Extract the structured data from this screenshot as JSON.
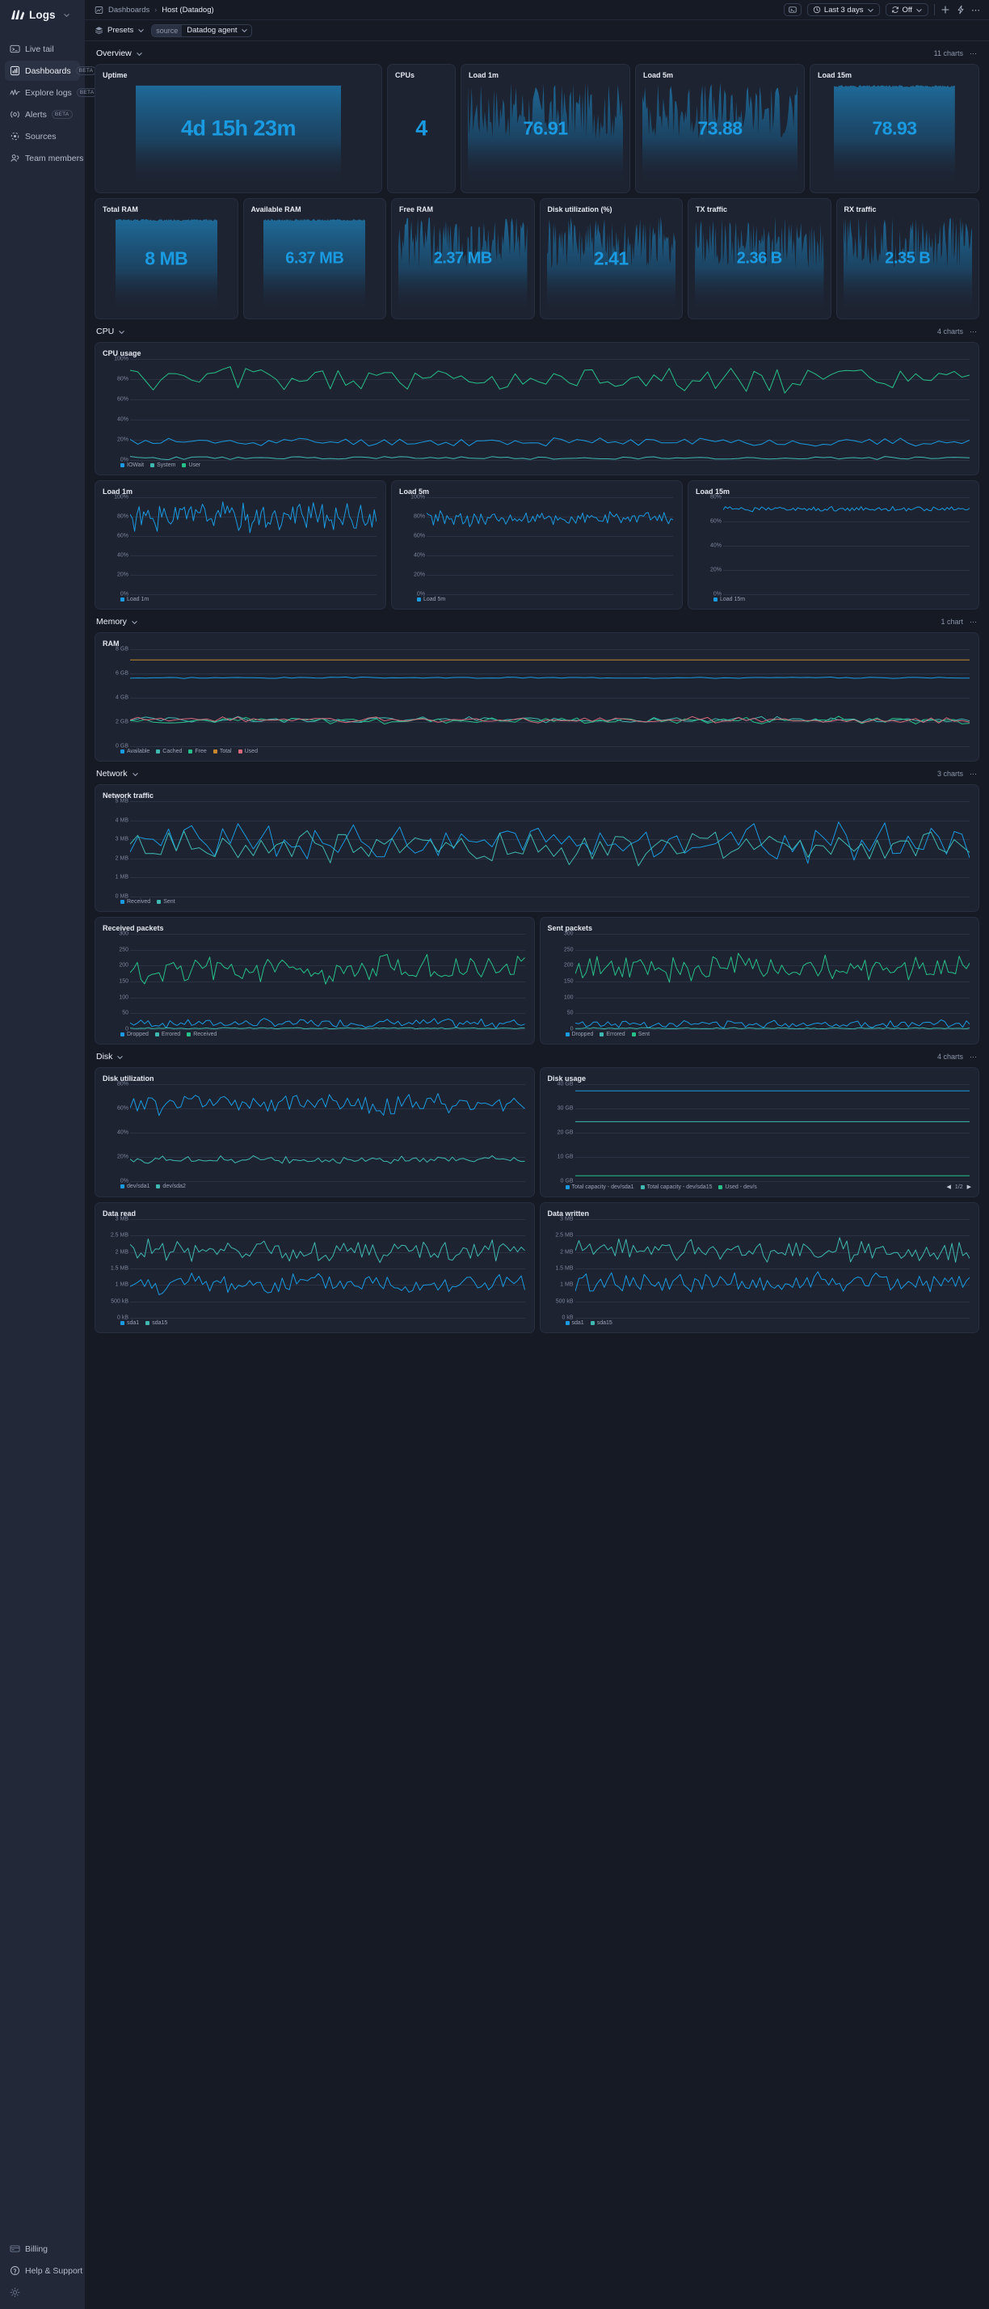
{
  "brand": {
    "name": "Logs",
    "logo_icon": "logs-logo-icon",
    "caret_icon": "chevron-down-icon"
  },
  "sidebar": {
    "items": [
      {
        "label": "Live tail",
        "icon": "terminal-icon",
        "badge": null,
        "active": false
      },
      {
        "label": "Dashboards",
        "icon": "bar-chart-icon",
        "badge": "BETA",
        "active": true
      },
      {
        "label": "Explore logs",
        "icon": "pulse-icon",
        "badge": "BETA",
        "active": false
      },
      {
        "label": "Alerts",
        "icon": "bell-icon",
        "badge": "BETA",
        "active": false
      },
      {
        "label": "Sources",
        "icon": "sources-icon",
        "badge": null,
        "active": false
      },
      {
        "label": "Team members",
        "icon": "users-icon",
        "badge": null,
        "active": false
      }
    ],
    "bottom_items": [
      {
        "label": "Billing",
        "icon": "credit-card-icon"
      },
      {
        "label": "Help & Support",
        "icon": "question-circle-icon"
      }
    ],
    "theme_toggle_icon": "sun-icon"
  },
  "topbar": {
    "breadcrumb_icon": "dashboard-icon",
    "breadcrumb_root": "Dashboards",
    "breadcrumb_sep": "›",
    "breadcrumb_current": "Host (Datadog)",
    "terminal_button_icon": "terminal-icon",
    "time_range": {
      "icon": "clock-icon",
      "label": "Last 3 days",
      "caret": "chevron-down-icon"
    },
    "refresh": {
      "icon": "refresh-icon",
      "label": "Off",
      "caret": "chevron-down-icon"
    },
    "add_icon": "plus-icon",
    "bolt_icon": "lightning-icon",
    "more_icon": "ellipsis-icon"
  },
  "filterbar": {
    "presets_icon": "layers-icon",
    "presets_label": "Presets",
    "presets_caret": "chevron-down-icon",
    "tag_key": "source",
    "tag_value": "Datadog agent",
    "tag_caret": "chevron-down-icon"
  },
  "sections": [
    {
      "id": "overview",
      "title": "Overview",
      "count": "11 charts"
    },
    {
      "id": "cpu",
      "title": "CPU",
      "count": "4 charts"
    },
    {
      "id": "memory",
      "title": "Memory",
      "count": "1 chart"
    },
    {
      "id": "network",
      "title": "Network",
      "count": "3 charts"
    },
    {
      "id": "disk",
      "title": "Disk",
      "count": "4 charts"
    }
  ],
  "overview_row1": [
    {
      "title": "Uptime",
      "value": "4d 15h 23m",
      "size": "lg",
      "spark": "flat"
    },
    {
      "title": "CPUs",
      "value": "4",
      "size": "lg",
      "spark": "none"
    },
    {
      "title": "Load 1m",
      "value": "76.91",
      "size": "md",
      "spark": "noisy"
    },
    {
      "title": "Load 5m",
      "value": "73.88",
      "size": "md",
      "spark": "noisy"
    },
    {
      "title": "Load 15m",
      "value": "78.93",
      "size": "md",
      "spark": "block"
    }
  ],
  "overview_row2": [
    {
      "title": "Total RAM",
      "value": "8 MB",
      "size": "md",
      "spark": "block"
    },
    {
      "title": "Available RAM",
      "value": "6.37 MB",
      "size": "sm",
      "spark": "block"
    },
    {
      "title": "Free RAM",
      "value": "2.37 MB",
      "size": "sm",
      "spark": "noisy"
    },
    {
      "title": "Disk utilization (%)",
      "value": "2.41",
      "size": "md",
      "spark": "noisy"
    },
    {
      "title": "TX traffic",
      "value": "2.36 B",
      "size": "sm",
      "spark": "noisy"
    },
    {
      "title": "RX traffic",
      "value": "2.35 B",
      "size": "sm",
      "spark": "noisy"
    }
  ],
  "chart_data": [
    {
      "id": "cpu-usage",
      "type": "line",
      "title": "CPU usage",
      "ylabel": "",
      "xlabel": "",
      "yticks": [
        "100%",
        "80%",
        "60%",
        "40%",
        "20%",
        "0%"
      ],
      "ylim": [
        0,
        100
      ],
      "grid": true,
      "legend_position": "bottom",
      "series": [
        {
          "name": "IOWait",
          "color": "#1a9ae0",
          "mean": 18,
          "amp": 4,
          "seed": 11
        },
        {
          "name": "System",
          "color": "#3fb9b0",
          "mean": 2,
          "amp": 1.5,
          "seed": 23
        },
        {
          "name": "User",
          "color": "#27c08a",
          "mean": 80,
          "amp": 12,
          "seed": 5
        }
      ]
    },
    {
      "id": "load-1m",
      "type": "line",
      "title": "Load 1m",
      "yticks": [
        "100%",
        "80%",
        "60%",
        "40%",
        "20%",
        "0%"
      ],
      "ylim": [
        0,
        100
      ],
      "grid": true,
      "series": [
        {
          "name": "Load 1m",
          "color": "#1a9ae0",
          "mean": 80,
          "amp": 14,
          "seed": 31
        }
      ]
    },
    {
      "id": "load-5m",
      "type": "line",
      "title": "Load 5m",
      "yticks": [
        "100%",
        "80%",
        "60%",
        "40%",
        "20%",
        "0%"
      ],
      "ylim": [
        0,
        100
      ],
      "grid": true,
      "series": [
        {
          "name": "Load 5m",
          "color": "#1a9ae0",
          "mean": 78,
          "amp": 7,
          "seed": 42
        }
      ]
    },
    {
      "id": "load-15m",
      "type": "line",
      "title": "Load 15m",
      "yticks": [
        "80%",
        "60%",
        "40%",
        "20%",
        "0%"
      ],
      "ylim": [
        0,
        90
      ],
      "grid": true,
      "series": [
        {
          "name": "Load 15m",
          "color": "#1a9ae0",
          "mean": 79,
          "amp": 2,
          "seed": 57
        }
      ]
    },
    {
      "id": "ram",
      "type": "line",
      "title": "RAM",
      "yticks": [
        "8 GB",
        "6 GB",
        "4 GB",
        "2 GB",
        "0 GB"
      ],
      "ylim": [
        0,
        9
      ],
      "grid": true,
      "series": [
        {
          "name": "Available",
          "color": "#1a9ae0",
          "mean": 6.35,
          "amp": 0.06,
          "seed": 3
        },
        {
          "name": "Cached",
          "color": "#3fb9b0",
          "mean": 2.45,
          "amp": 0.25,
          "seed": 14
        },
        {
          "name": "Free",
          "color": "#27c08a",
          "mean": 2.4,
          "amp": 0.3,
          "seed": 26
        },
        {
          "name": "Total",
          "color": "#c8872d",
          "mean": 8.0,
          "amp": 0,
          "seed": 1
        },
        {
          "name": "Used",
          "color": "#d9687c",
          "mean": 2.45,
          "amp": 0.25,
          "seed": 38
        }
      ]
    },
    {
      "id": "network-traffic",
      "type": "line",
      "title": "Network traffic",
      "yticks": [
        "5 MB",
        "4 MB",
        "3 MB",
        "2 MB",
        "1 MB",
        "0 MB"
      ],
      "ylim": [
        0,
        5.4
      ],
      "grid": true,
      "series": [
        {
          "name": "Received",
          "color": "#1a9ae0",
          "mean": 3.1,
          "amp": 1.0,
          "seed": 9
        },
        {
          "name": "Sent",
          "color": "#3fb9b0",
          "mean": 2.8,
          "amp": 0.9,
          "seed": 19
        }
      ]
    },
    {
      "id": "received-packets",
      "type": "line",
      "title": "Received packets",
      "yticks": [
        "300",
        "250",
        "200",
        "150",
        "100",
        "50",
        "0"
      ],
      "ylim": [
        0,
        320
      ],
      "grid": true,
      "series": [
        {
          "name": "Dropped",
          "color": "#1a9ae0",
          "mean": 20,
          "amp": 14,
          "seed": 7
        },
        {
          "name": "Errored",
          "color": "#3fb9b0",
          "mean": 3,
          "amp": 2,
          "seed": 17
        },
        {
          "name": "Received",
          "color": "#27c08a",
          "mean": 200,
          "amp": 42,
          "seed": 27
        }
      ]
    },
    {
      "id": "sent-packets",
      "type": "line",
      "title": "Sent packets",
      "yticks": [
        "300",
        "250",
        "200",
        "150",
        "100",
        "50",
        "0"
      ],
      "ylim": [
        0,
        320
      ],
      "grid": true,
      "series": [
        {
          "name": "Dropped",
          "color": "#1a9ae0",
          "mean": 18,
          "amp": 12,
          "seed": 13
        },
        {
          "name": "Errored",
          "color": "#3fb9b0",
          "mean": 3,
          "amp": 2,
          "seed": 21
        },
        {
          "name": "Sent",
          "color": "#27c08a",
          "mean": 205,
          "amp": 40,
          "seed": 33
        }
      ]
    },
    {
      "id": "disk-utilization",
      "type": "line",
      "title": "Disk utilization",
      "yticks": [
        "80%",
        "60%",
        "40%",
        "20%",
        "0%"
      ],
      "ylim": [
        0,
        90
      ],
      "grid": true,
      "series": [
        {
          "name": "dev/sda1",
          "color": "#1a9ae0",
          "mean": 72,
          "amp": 9,
          "seed": 15
        },
        {
          "name": "dev/sda2",
          "color": "#3fb9b0",
          "mean": 20,
          "amp": 3,
          "seed": 25
        }
      ]
    },
    {
      "id": "disk-usage",
      "type": "line",
      "title": "Disk usage",
      "yticks": [
        "40 GB",
        "30 GB",
        "20 GB",
        "10 GB",
        "0 GB"
      ],
      "ylim": [
        0,
        44
      ],
      "grid": true,
      "pagination": "1/2",
      "series": [
        {
          "name": "Total capacity - dev/sda1",
          "color": "#1a9ae0",
          "mean": 41,
          "amp": 0,
          "seed": 2
        },
        {
          "name": "Total capacity - dev/sda15",
          "color": "#3fb9b0",
          "mean": 27,
          "amp": 0,
          "seed": 4
        },
        {
          "name": "Used - dev/s",
          "color": "#27c08a",
          "mean": 2.5,
          "amp": 0,
          "seed": 6
        }
      ]
    },
    {
      "id": "data-read",
      "type": "line",
      "title": "Data read",
      "yticks": [
        "3 MB",
        "2.5 MB",
        "2 MB",
        "1.5 MB",
        "1 MB",
        "500 kB",
        "0 kB"
      ],
      "ylim": [
        0,
        3.2
      ],
      "grid": true,
      "series": [
        {
          "name": "sda1",
          "color": "#1a9ae0",
          "mean": 1.1,
          "amp": 0.33,
          "seed": 8
        },
        {
          "name": "sda15",
          "color": "#3fb9b0",
          "mean": 2.18,
          "amp": 0.33,
          "seed": 18
        }
      ]
    },
    {
      "id": "data-written",
      "type": "line",
      "title": "Data written",
      "yticks": [
        "3 MB",
        "2.5 MB",
        "2 MB",
        "1.5 MB",
        "1 MB",
        "500 kB",
        "0 kB"
      ],
      "ylim": [
        0,
        3.2
      ],
      "grid": true,
      "series": [
        {
          "name": "sda1",
          "color": "#1a9ae0",
          "mean": 1.15,
          "amp": 0.32,
          "seed": 28
        },
        {
          "name": "sda15",
          "color": "#3fb9b0",
          "mean": 2.2,
          "amp": 0.33,
          "seed": 38
        }
      ]
    }
  ]
}
